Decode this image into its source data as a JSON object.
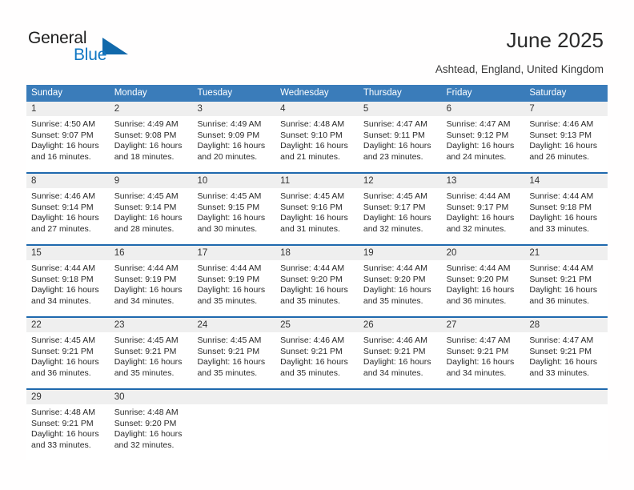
{
  "brand": {
    "name_part1": "General",
    "name_part2": "Blue"
  },
  "header": {
    "title": "June 2025",
    "location": "Ashtead, England, United Kingdom"
  },
  "colors": {
    "header_blue": "#3a7cba",
    "separator_blue": "#1f69ae",
    "date_band": "#efefef",
    "brand_blue": "#1077c3",
    "logo_triangle": "#1169ab"
  },
  "weekdays": [
    "Sunday",
    "Monday",
    "Tuesday",
    "Wednesday",
    "Thursday",
    "Friday",
    "Saturday"
  ],
  "weeks": [
    {
      "days": [
        {
          "num": "1",
          "sunrise": "Sunrise: 4:50 AM",
          "sunset": "Sunset: 9:07 PM",
          "daylight1": "Daylight: 16 hours",
          "daylight2": "and 16 minutes."
        },
        {
          "num": "2",
          "sunrise": "Sunrise: 4:49 AM",
          "sunset": "Sunset: 9:08 PM",
          "daylight1": "Daylight: 16 hours",
          "daylight2": "and 18 minutes."
        },
        {
          "num": "3",
          "sunrise": "Sunrise: 4:49 AM",
          "sunset": "Sunset: 9:09 PM",
          "daylight1": "Daylight: 16 hours",
          "daylight2": "and 20 minutes."
        },
        {
          "num": "4",
          "sunrise": "Sunrise: 4:48 AM",
          "sunset": "Sunset: 9:10 PM",
          "daylight1": "Daylight: 16 hours",
          "daylight2": "and 21 minutes."
        },
        {
          "num": "5",
          "sunrise": "Sunrise: 4:47 AM",
          "sunset": "Sunset: 9:11 PM",
          "daylight1": "Daylight: 16 hours",
          "daylight2": "and 23 minutes."
        },
        {
          "num": "6",
          "sunrise": "Sunrise: 4:47 AM",
          "sunset": "Sunset: 9:12 PM",
          "daylight1": "Daylight: 16 hours",
          "daylight2": "and 24 minutes."
        },
        {
          "num": "7",
          "sunrise": "Sunrise: 4:46 AM",
          "sunset": "Sunset: 9:13 PM",
          "daylight1": "Daylight: 16 hours",
          "daylight2": "and 26 minutes."
        }
      ]
    },
    {
      "days": [
        {
          "num": "8",
          "sunrise": "Sunrise: 4:46 AM",
          "sunset": "Sunset: 9:14 PM",
          "daylight1": "Daylight: 16 hours",
          "daylight2": "and 27 minutes."
        },
        {
          "num": "9",
          "sunrise": "Sunrise: 4:45 AM",
          "sunset": "Sunset: 9:14 PM",
          "daylight1": "Daylight: 16 hours",
          "daylight2": "and 28 minutes."
        },
        {
          "num": "10",
          "sunrise": "Sunrise: 4:45 AM",
          "sunset": "Sunset: 9:15 PM",
          "daylight1": "Daylight: 16 hours",
          "daylight2": "and 30 minutes."
        },
        {
          "num": "11",
          "sunrise": "Sunrise: 4:45 AM",
          "sunset": "Sunset: 9:16 PM",
          "daylight1": "Daylight: 16 hours",
          "daylight2": "and 31 minutes."
        },
        {
          "num": "12",
          "sunrise": "Sunrise: 4:45 AM",
          "sunset": "Sunset: 9:17 PM",
          "daylight1": "Daylight: 16 hours",
          "daylight2": "and 32 minutes."
        },
        {
          "num": "13",
          "sunrise": "Sunrise: 4:44 AM",
          "sunset": "Sunset: 9:17 PM",
          "daylight1": "Daylight: 16 hours",
          "daylight2": "and 32 minutes."
        },
        {
          "num": "14",
          "sunrise": "Sunrise: 4:44 AM",
          "sunset": "Sunset: 9:18 PM",
          "daylight1": "Daylight: 16 hours",
          "daylight2": "and 33 minutes."
        }
      ]
    },
    {
      "days": [
        {
          "num": "15",
          "sunrise": "Sunrise: 4:44 AM",
          "sunset": "Sunset: 9:18 PM",
          "daylight1": "Daylight: 16 hours",
          "daylight2": "and 34 minutes."
        },
        {
          "num": "16",
          "sunrise": "Sunrise: 4:44 AM",
          "sunset": "Sunset: 9:19 PM",
          "daylight1": "Daylight: 16 hours",
          "daylight2": "and 34 minutes."
        },
        {
          "num": "17",
          "sunrise": "Sunrise: 4:44 AM",
          "sunset": "Sunset: 9:19 PM",
          "daylight1": "Daylight: 16 hours",
          "daylight2": "and 35 minutes."
        },
        {
          "num": "18",
          "sunrise": "Sunrise: 4:44 AM",
          "sunset": "Sunset: 9:20 PM",
          "daylight1": "Daylight: 16 hours",
          "daylight2": "and 35 minutes."
        },
        {
          "num": "19",
          "sunrise": "Sunrise: 4:44 AM",
          "sunset": "Sunset: 9:20 PM",
          "daylight1": "Daylight: 16 hours",
          "daylight2": "and 35 minutes."
        },
        {
          "num": "20",
          "sunrise": "Sunrise: 4:44 AM",
          "sunset": "Sunset: 9:20 PM",
          "daylight1": "Daylight: 16 hours",
          "daylight2": "and 36 minutes."
        },
        {
          "num": "21",
          "sunrise": "Sunrise: 4:44 AM",
          "sunset": "Sunset: 9:21 PM",
          "daylight1": "Daylight: 16 hours",
          "daylight2": "and 36 minutes."
        }
      ]
    },
    {
      "days": [
        {
          "num": "22",
          "sunrise": "Sunrise: 4:45 AM",
          "sunset": "Sunset: 9:21 PM",
          "daylight1": "Daylight: 16 hours",
          "daylight2": "and 36 minutes."
        },
        {
          "num": "23",
          "sunrise": "Sunrise: 4:45 AM",
          "sunset": "Sunset: 9:21 PM",
          "daylight1": "Daylight: 16 hours",
          "daylight2": "and 35 minutes."
        },
        {
          "num": "24",
          "sunrise": "Sunrise: 4:45 AM",
          "sunset": "Sunset: 9:21 PM",
          "daylight1": "Daylight: 16 hours",
          "daylight2": "and 35 minutes."
        },
        {
          "num": "25",
          "sunrise": "Sunrise: 4:46 AM",
          "sunset": "Sunset: 9:21 PM",
          "daylight1": "Daylight: 16 hours",
          "daylight2": "and 35 minutes."
        },
        {
          "num": "26",
          "sunrise": "Sunrise: 4:46 AM",
          "sunset": "Sunset: 9:21 PM",
          "daylight1": "Daylight: 16 hours",
          "daylight2": "and 34 minutes."
        },
        {
          "num": "27",
          "sunrise": "Sunrise: 4:47 AM",
          "sunset": "Sunset: 9:21 PM",
          "daylight1": "Daylight: 16 hours",
          "daylight2": "and 34 minutes."
        },
        {
          "num": "28",
          "sunrise": "Sunrise: 4:47 AM",
          "sunset": "Sunset: 9:21 PM",
          "daylight1": "Daylight: 16 hours",
          "daylight2": "and 33 minutes."
        }
      ]
    },
    {
      "days": [
        {
          "num": "29",
          "sunrise": "Sunrise: 4:48 AM",
          "sunset": "Sunset: 9:21 PM",
          "daylight1": "Daylight: 16 hours",
          "daylight2": "and 33 minutes."
        },
        {
          "num": "30",
          "sunrise": "Sunrise: 4:48 AM",
          "sunset": "Sunset: 9:20 PM",
          "daylight1": "Daylight: 16 hours",
          "daylight2": "and 32 minutes."
        },
        {
          "num": "",
          "sunrise": "",
          "sunset": "",
          "daylight1": "",
          "daylight2": ""
        },
        {
          "num": "",
          "sunrise": "",
          "sunset": "",
          "daylight1": "",
          "daylight2": ""
        },
        {
          "num": "",
          "sunrise": "",
          "sunset": "",
          "daylight1": "",
          "daylight2": ""
        },
        {
          "num": "",
          "sunrise": "",
          "sunset": "",
          "daylight1": "",
          "daylight2": ""
        },
        {
          "num": "",
          "sunrise": "",
          "sunset": "",
          "daylight1": "",
          "daylight2": ""
        }
      ]
    }
  ]
}
